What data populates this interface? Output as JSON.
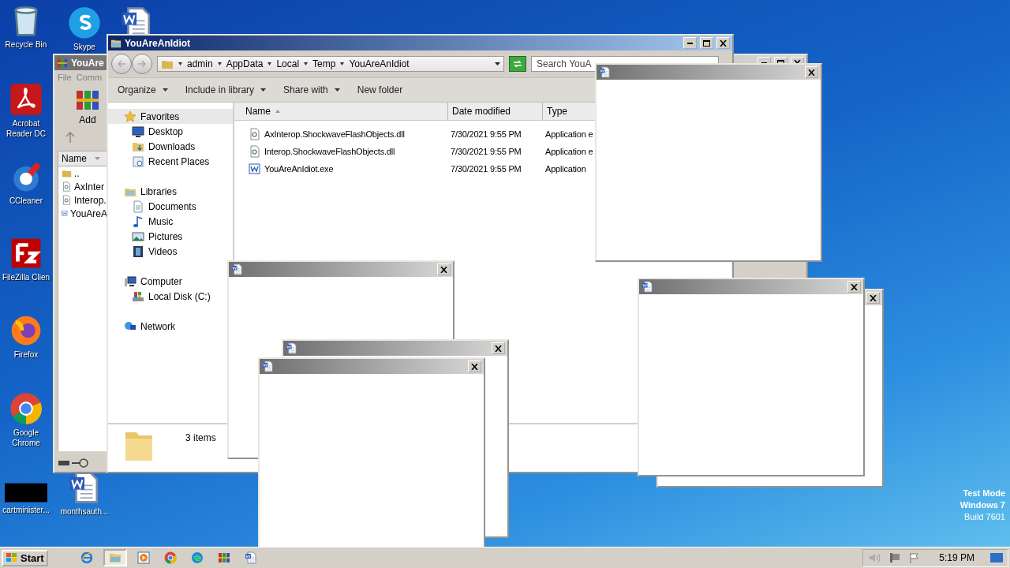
{
  "desktop": {
    "icons": [
      {
        "kind": "recycle",
        "label": "Recycle Bin"
      },
      {
        "kind": "skype",
        "label": "Skype"
      },
      {
        "kind": "word"
      },
      {
        "kind": "acrobat",
        "label": "Acrobat Reader DC"
      },
      {
        "kind": "ccleaner",
        "label": "CCleaner"
      },
      {
        "kind": "filezilla",
        "label": "FileZilla Clien"
      },
      {
        "kind": "firefox",
        "label": "Firefox"
      },
      {
        "kind": "chrome",
        "label": "Google Chrome"
      },
      {
        "kind": "black",
        "label": "cartminister..."
      },
      {
        "kind": "word",
        "label": "monthsauth..."
      }
    ],
    "edition": [
      "Test Mode",
      "Windows 7",
      "Build 7601"
    ]
  },
  "winrar": {
    "title": "YouAre",
    "menu": [
      "File",
      "Comm"
    ],
    "tool": "Add",
    "column": "Name",
    "rows": [
      {
        "kind": "up",
        "name": ".."
      },
      {
        "kind": "dll",
        "name": "AxInter"
      },
      {
        "kind": "dll",
        "name": "Interop."
      },
      {
        "kind": "exe",
        "name": "YouAreA"
      }
    ]
  },
  "explorer": {
    "title": "YouAreAnIdiot",
    "path": [
      "admin",
      "AppData",
      "Local",
      "Temp",
      "YouAreAnIdiot"
    ],
    "search": {
      "placeholder": "Search YouA"
    },
    "commands": [
      {
        "label": "Organize",
        "dropdown": true
      },
      {
        "label": "Include in library",
        "dropdown": true
      },
      {
        "label": "Share with",
        "dropdown": true
      },
      {
        "label": "New folder",
        "dropdown": false
      }
    ],
    "nav": [
      {
        "kind": "star",
        "label": "Favorites",
        "selected": true,
        "children": [
          {
            "kind": "desktop",
            "label": "Desktop",
            "selected": false
          },
          {
            "kind": "downloads",
            "label": "Downloads",
            "selected": false
          },
          {
            "kind": "recent",
            "label": "Recent Places",
            "selected": false
          }
        ]
      },
      {
        "kind": "library",
        "label": "Libraries",
        "selected": false,
        "children": [
          {
            "kind": "document",
            "label": "Documents",
            "selected": false
          },
          {
            "kind": "music",
            "label": "Music",
            "selected": false
          },
          {
            "kind": "pictures",
            "label": "Pictures",
            "selected": false
          },
          {
            "kind": "videos",
            "label": "Videos",
            "selected": false
          }
        ]
      },
      {
        "kind": "computer",
        "label": "Computer",
        "selected": false,
        "children": [
          {
            "kind": "disk",
            "label": "Local Disk (C:)",
            "selected": false
          }
        ]
      },
      {
        "kind": "network",
        "label": "Network",
        "selected": false
      }
    ],
    "columns": [
      {
        "label": "Name",
        "sorted": true
      },
      {
        "label": "Date modified",
        "sorted": false
      },
      {
        "label": "Type",
        "sorted": false
      }
    ],
    "rows": [
      {
        "kind": "dll",
        "name": "AxInterop.ShockwaveFlashObjects.dll",
        "date": "7/30/2021 9:55 PM",
        "type": "Application e"
      },
      {
        "kind": "dll",
        "name": "Interop.ShockwaveFlashObjects.dll",
        "date": "7/30/2021 9:55 PM",
        "type": "Application e"
      },
      {
        "kind": "exe",
        "name": "YouAreAnIdiot.exe",
        "date": "7/30/2021 9:55 PM",
        "type": "Application"
      }
    ],
    "details": "3 items"
  },
  "popups": [
    {
      "kind": "blank"
    },
    {
      "kind": "blank"
    },
    {
      "kind": "blank"
    },
    {
      "kind": "blank"
    },
    {
      "kind": "blank"
    },
    {
      "kind": "blank"
    }
  ],
  "taskbar": {
    "start": "Start",
    "apps": [
      {
        "kind": "ie",
        "selected": false
      },
      {
        "kind": "explorer",
        "selected": true
      },
      {
        "kind": "media",
        "selected": false
      },
      {
        "kind": "chrome",
        "selected": false
      },
      {
        "kind": "edge",
        "selected": false
      },
      {
        "kind": "winrar",
        "selected": false
      },
      {
        "kind": "word",
        "selected": false
      }
    ],
    "clock": "5:19 PM"
  }
}
